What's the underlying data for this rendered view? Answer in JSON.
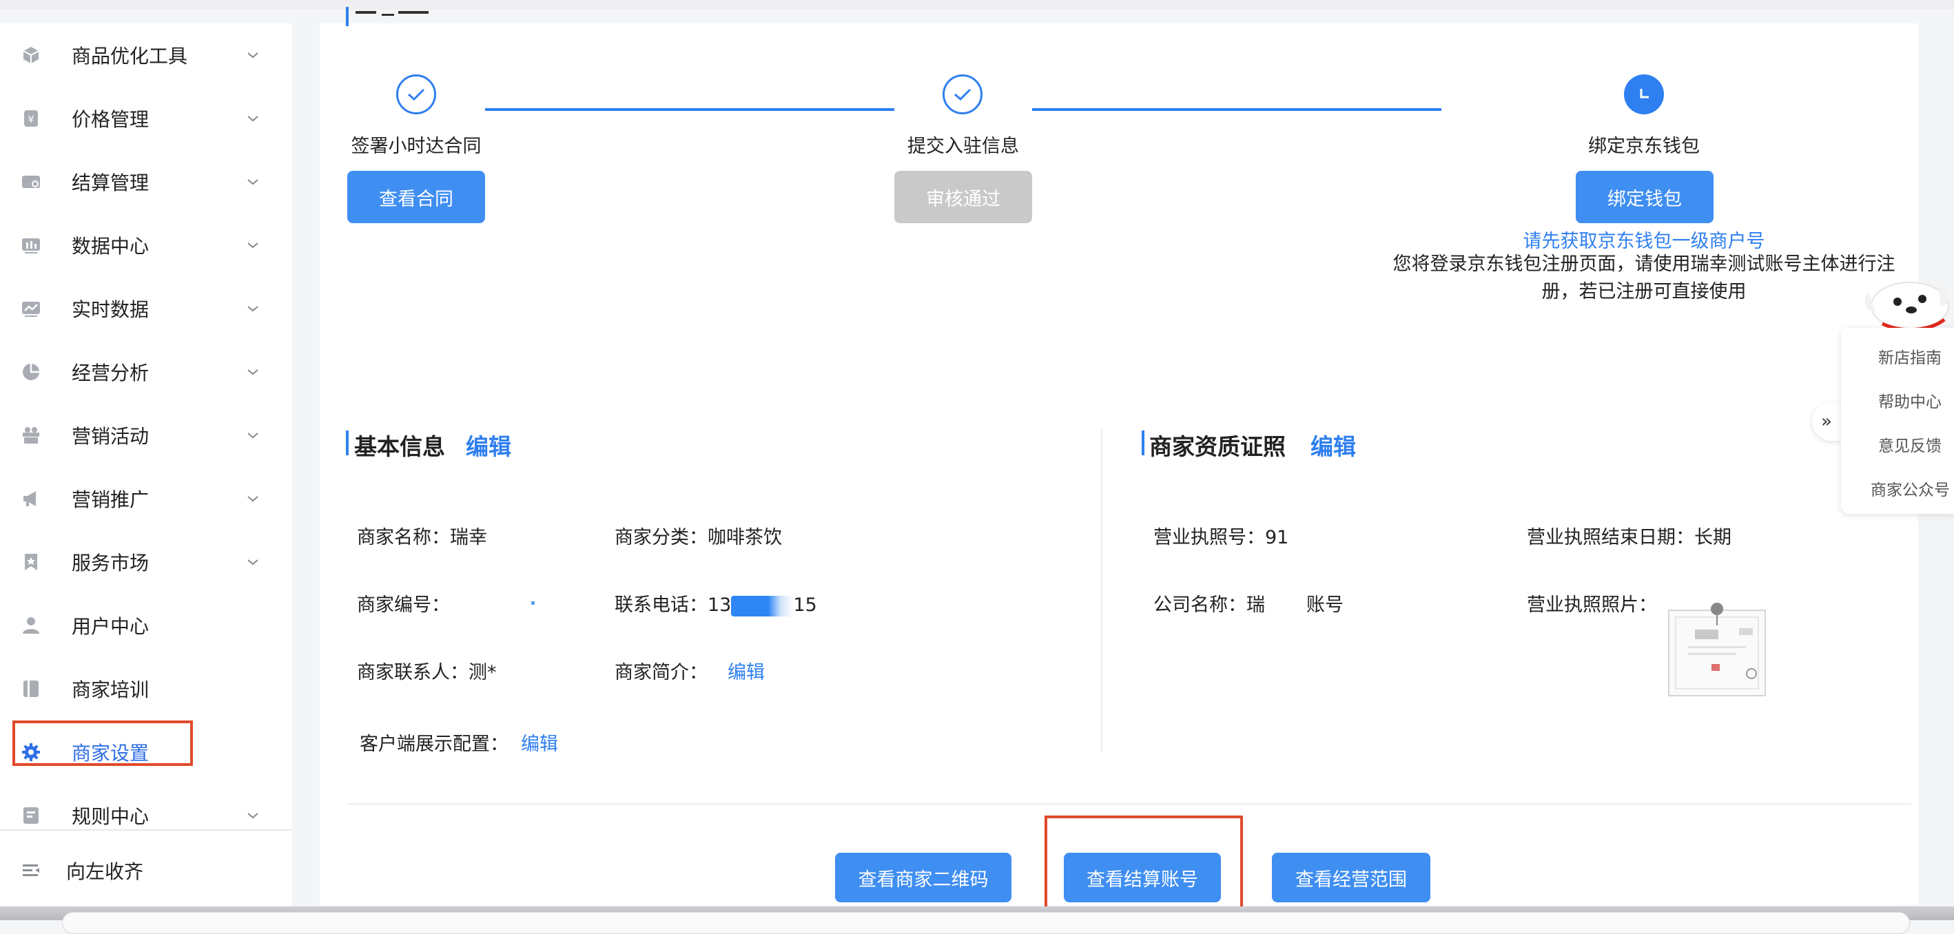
{
  "sidebar": {
    "items": [
      {
        "label": "商品优化工具",
        "icon": "cube-icon",
        "has_chevron": true
      },
      {
        "label": "价格管理",
        "icon": "price-tag-icon",
        "has_chevron": true
      },
      {
        "label": "结算管理",
        "icon": "settlement-icon",
        "has_chevron": true
      },
      {
        "label": "数据中心",
        "icon": "bar-chart-icon",
        "has_chevron": true
      },
      {
        "label": "实时数据",
        "icon": "line-chart-icon",
        "has_chevron": true
      },
      {
        "label": "经营分析",
        "icon": "pie-chart-icon",
        "has_chevron": true
      },
      {
        "label": "营销活动",
        "icon": "gift-icon",
        "has_chevron": true
      },
      {
        "label": "营销推广",
        "icon": "megaphone-icon",
        "has_chevron": true
      },
      {
        "label": "服务市场",
        "icon": "bookmark-star-icon",
        "has_chevron": true
      },
      {
        "label": "用户中心",
        "icon": "user-icon",
        "has_chevron": false
      },
      {
        "label": "商家培训",
        "icon": "book-icon",
        "has_chevron": false
      },
      {
        "label": "商家设置",
        "icon": "gear-icon",
        "has_chevron": false,
        "active": true
      },
      {
        "label": "规则中心",
        "icon": "rules-icon",
        "has_chevron": true
      }
    ],
    "collapse_label": "向左收齐"
  },
  "steps": [
    {
      "label": "签署小时达合同",
      "status": "done",
      "button": "查看合同"
    },
    {
      "label": "提交入驻信息",
      "status": "done",
      "button": "审核通过"
    },
    {
      "label": "绑定京东钱包",
      "status": "current",
      "button": "绑定钱包"
    }
  ],
  "wallet": {
    "hint": "请先获取京东钱包一级商户号",
    "note_line1": "您将登录京东钱包注册页面，请使用瑞幸测试账号主体进行注",
    "note_line2": "册，若已注册可直接使用"
  },
  "basic_info": {
    "title": "基本信息",
    "edit": "编辑",
    "merchant_name_label": "商家名称：",
    "merchant_name_value": "瑞幸",
    "category_label": "商家分类：",
    "category_value": "咖啡茶饮",
    "merchant_no_label": "商家编号：",
    "phone_label": "联系电话：",
    "phone_prefix": "13",
    "phone_suffix": "15",
    "contact_label": "商家联系人：",
    "contact_value": "测*",
    "intro_label": "商家简介：",
    "intro_edit": "编辑",
    "display_config_label": "客户端展示配置：",
    "display_config_edit": "编辑"
  },
  "license": {
    "title": "商家资质证照",
    "edit": "编辑",
    "license_no_label": "营业执照号：",
    "license_no_value": "91",
    "license_end_label": "营业执照结束日期：",
    "license_end_value": "长期",
    "company_label": "公司名称：",
    "company_prefix": "瑞",
    "company_suffix": "账号",
    "photo_label": "营业执照照片："
  },
  "bottom_buttons": {
    "qrcode": "查看商家二维码",
    "settlement": "查看结算账号",
    "scope": "查看经营范围"
  },
  "float_panel": {
    "items": [
      "新店指南",
      "帮助中心",
      "意见反馈",
      "商家公众号"
    ],
    "expand": "»"
  },
  "colors": {
    "accent": "#2e7ff0",
    "button_blue": "#3f8ef2",
    "button_gray": "#c9c9c9",
    "highlight_box": "#e04a2a"
  }
}
